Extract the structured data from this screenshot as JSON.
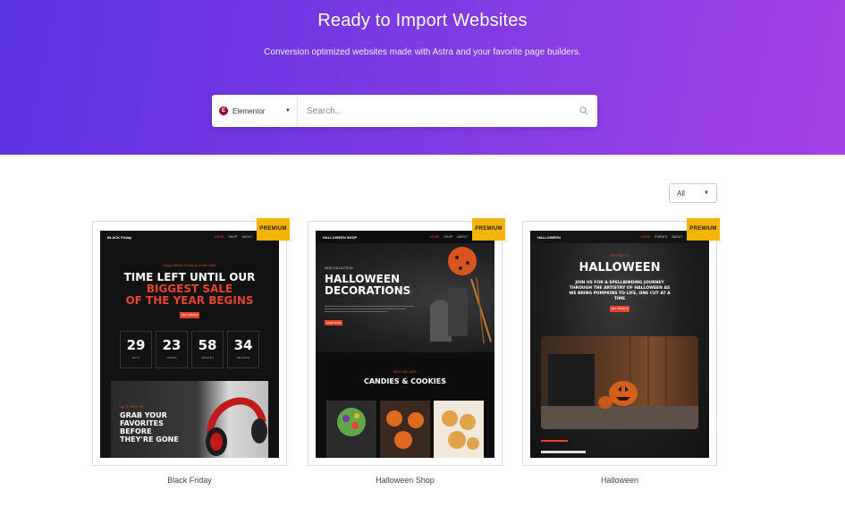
{
  "hero": {
    "title": "Ready to Import Websites",
    "subtitle": "Conversion optimized websites made with Astra and your favorite page builders."
  },
  "search": {
    "builder_logo": "E",
    "builder_label": "Elementor",
    "placeholder": "Search.."
  },
  "filter": {
    "selected": "All"
  },
  "templates": [
    {
      "name": "Black Friday",
      "badge": "PREMIUM",
      "preview": {
        "logo": "BLACK Friday",
        "nav": [
          "HOME",
          "SHOP",
          "ABOUT",
          "CONTACT"
        ],
        "tagline": "Happy Black Friday & Great Sale!",
        "headline_1": "TIME LEFT UNTIL OUR",
        "headline_hl": "BIGGEST SALE",
        "headline_2": "OF THE YEAR BEGINS",
        "cta": "GET OFFERS",
        "countdown": [
          {
            "value": "29",
            "unit": "DAYS"
          },
          {
            "value": "23",
            "unit": "HOURS"
          },
          {
            "value": "58",
            "unit": "MINUTES"
          },
          {
            "value": "34",
            "unit": "SECONDS"
          }
        ],
        "promo_tag": "Up To 50% Off",
        "promo_title": "GRAB YOUR FAVORITES BEFORE THEY'RE GONE"
      }
    },
    {
      "name": "Halloween Shop",
      "badge": "PREMIUM",
      "preview": {
        "logo": "HALLOWEEN SHOP",
        "nav": [
          "HOME",
          "SHOP",
          "ABOUT",
          "CONTACT"
        ],
        "kicker": "NEW COLLECTION",
        "title": "HALLOWEEN DECORATIONS",
        "cta": "SHOP NOW",
        "section_kicker": "BEST SELLERS",
        "section_title": "CANDIES & COOKIES"
      }
    },
    {
      "name": "Halloween",
      "badge": "PREMIUM",
      "preview": {
        "logo": "HALLOWEEN",
        "nav": [
          "HOME",
          "EVENTS",
          "ABOUT",
          "CONTACT"
        ],
        "kicker": "OCTOBER 31",
        "title": "HALLOWEEN",
        "body": "JOIN US FOR A SPELLBINDING JOURNEY THROUGH THE ARTISTRY OF HALLOWEEN AS WE BRING PUMPKINS TO LIFE, ONE CUT AT A TIME",
        "cta": "GET TICKETS"
      }
    }
  ],
  "colors": {
    "hero_start": "#5b33e0",
    "hero_end": "#a442e6",
    "badge": "#f4b400",
    "accent_red": "#e8432c",
    "elementor": "#92003b"
  }
}
